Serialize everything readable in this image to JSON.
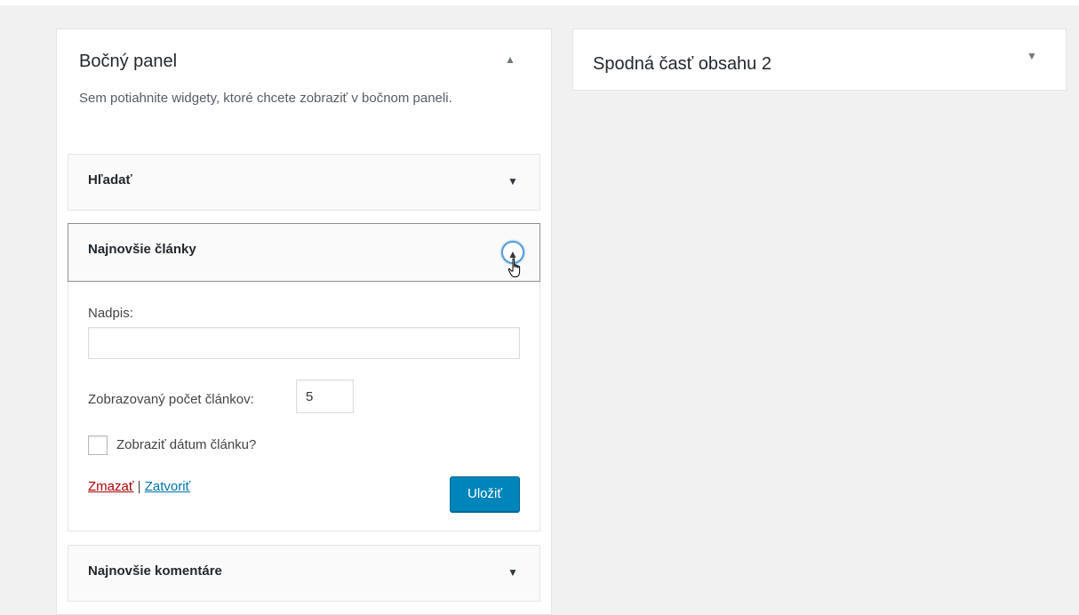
{
  "sidebar": {
    "title": "Bočný panel",
    "toggle_icon": "▲",
    "description": "Sem potiahnite widgety, ktoré chcete zobraziť v bočnom paneli.",
    "widgets": [
      {
        "title": "Hľadať",
        "arrow": "▼",
        "state": "collapsed"
      },
      {
        "title": "Najnovšie články",
        "arrow": "▲",
        "state": "expanded",
        "form": {
          "title_label": "Nadpis:",
          "title_value": "",
          "count_label": "Zobrazovaný počet článkov:",
          "count_value": "5",
          "show_date_label": "Zobraziť dátum článku?",
          "show_date_checked": false,
          "delete_label": "Zmazať",
          "separator": "|",
          "close_label": "Zatvoriť",
          "save_label": "Uložiť"
        }
      },
      {
        "title": "Najnovšie komentáre",
        "arrow": "▼",
        "state": "collapsed"
      }
    ]
  },
  "footer_panel": {
    "title": "Spodná časť obsahu 2",
    "toggle_icon": "▼"
  },
  "colors": {
    "background": "#f1f1f1",
    "primary_button": "#0085ba",
    "delete_link": "#aa0000",
    "link": "#0073aa",
    "focus_ring": "#5b9dd9"
  }
}
